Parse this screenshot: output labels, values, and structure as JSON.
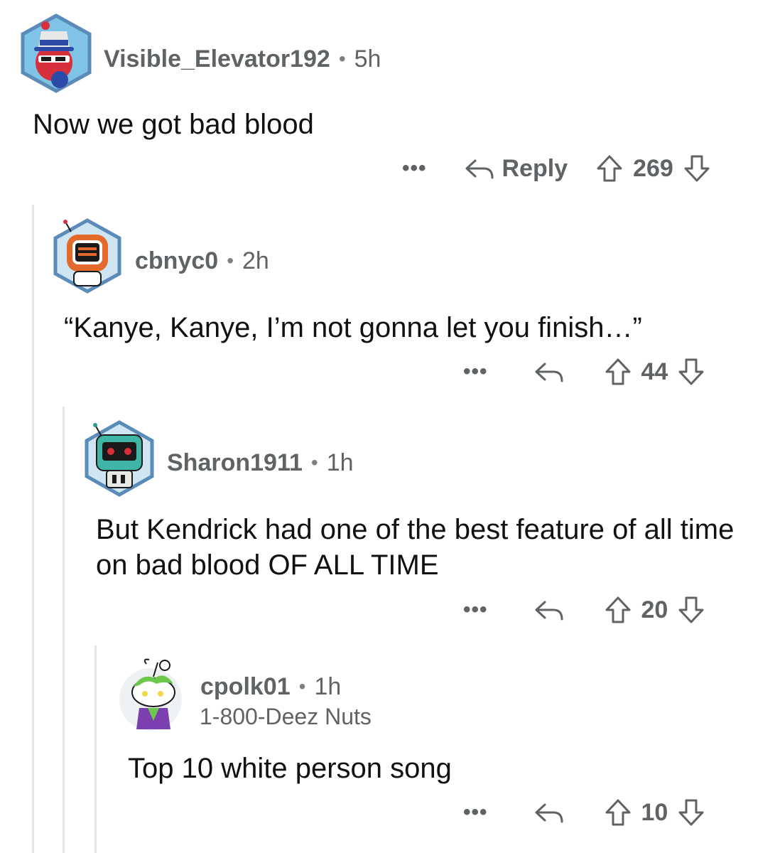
{
  "comments": [
    {
      "username": "Visible_Elevator192",
      "time": "5h",
      "flair": "",
      "body": "Now we got bad blood",
      "reply_label": "Reply",
      "score": "269",
      "more": "•••"
    },
    {
      "username": "cbnyc0",
      "time": "2h",
      "flair": "",
      "body": "“Kanye, Kanye, I’m not gonna let you finish…”",
      "reply_label": "",
      "score": "44",
      "more": "•••"
    },
    {
      "username": "Sharon1911",
      "time": "1h",
      "flair": "",
      "body": "But Kendrick had one of the best feature of all time on bad blood OF ALL TIME",
      "reply_label": "",
      "score": "20",
      "more": "•••"
    },
    {
      "username": "cpolk01",
      "time": "1h",
      "flair": "1-800-Deez Nuts",
      "body": "Top 10 white person song",
      "reply_label": "",
      "score": "10",
      "more": "•••"
    }
  ],
  "separator": "•",
  "icons": {
    "avatar_1": "uncle-sam-hat-avatar",
    "avatar_2": "orange-robot-avatar",
    "avatar_3": "teal-robot-avatar",
    "avatar_4": "snoo-green-hair-avatar",
    "reply": "reply-arrow-icon",
    "upvote": "upvote-arrow-icon",
    "downvote": "downvote-arrow-icon"
  },
  "colors": {
    "thread_line": "#e4e6e8",
    "meta_text": "#5f6366",
    "avatar_ring": "#5b8bb8"
  }
}
